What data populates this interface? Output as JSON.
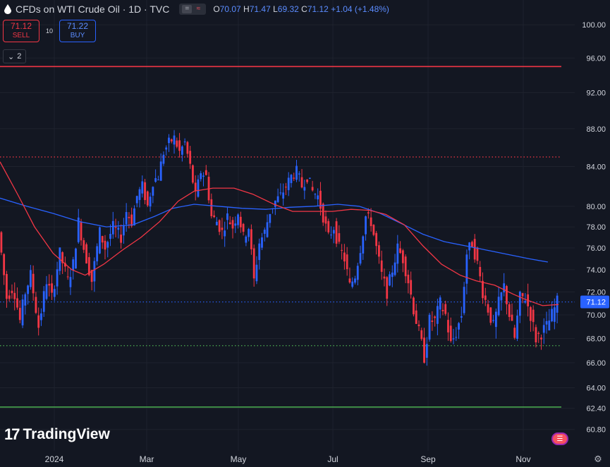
{
  "header": {
    "title": "CFDs on WTI Crude Oil · 1D · TVC",
    "ohlc": {
      "o_label": "O",
      "o": "70.07",
      "h_label": "H",
      "h": "71.47",
      "l_label": "L",
      "l": "69.32",
      "c_label": "C",
      "c": "71.12",
      "change": "+1.04 (+1.48%)"
    }
  },
  "trade": {
    "sell_price": "71.12",
    "sell_label": "SELL",
    "quantity": "10",
    "buy_price": "71.22",
    "buy_label": "BUY"
  },
  "indicators_toggle": {
    "label": "2",
    "icon": "chevron-down-icon"
  },
  "branding": {
    "logo_text": "TradingView",
    "logo_mark": "17"
  },
  "colors": {
    "background": "#131722",
    "up": "#2962ff",
    "down": "#f23645",
    "ma_fast": "#f23645",
    "ma_slow": "#2962ff",
    "resistance": "#f23645",
    "support": "#4caf50"
  },
  "chart_data": {
    "type": "candlestick",
    "x_axis_labels": [
      "2024",
      "Mar",
      "May",
      "Jul",
      "Sep",
      "Nov"
    ],
    "y_axis_labels": [
      "100.00",
      "96.00",
      "92.00",
      "88.00",
      "84.00",
      "80.00",
      "78.00",
      "76.00",
      "74.00",
      "72.00",
      "70.00",
      "68.00",
      "66.00",
      "64.00",
      "62.40",
      "60.80"
    ],
    "scale": "log",
    "ylim": [
      60.0,
      101.5
    ],
    "last_price": "71.12",
    "horizontal_lines": [
      {
        "price": 95.0,
        "style": "solid",
        "color": "#f23645"
      },
      {
        "price": 85.0,
        "style": "dotted",
        "color": "#f23645"
      },
      {
        "price": 71.12,
        "style": "dotted",
        "color": "#2962ff"
      },
      {
        "price": 67.4,
        "style": "dotted",
        "color": "#4caf50"
      },
      {
        "price": 62.5,
        "style": "solid",
        "color": "#4caf50"
      }
    ],
    "price_path": [
      [
        0,
        77.5
      ],
      [
        6,
        71.5
      ],
      [
        11,
        72.5
      ],
      [
        16,
        69.5
      ],
      [
        20,
        72.0
      ],
      [
        24,
        73.5
      ],
      [
        30,
        69.0
      ],
      [
        36,
        73.0
      ],
      [
        40,
        71.5
      ],
      [
        46,
        75.5
      ],
      [
        52,
        73.0
      ],
      [
        56,
        74.5
      ],
      [
        60,
        78.5
      ],
      [
        64,
        76.0
      ],
      [
        70,
        73.0
      ],
      [
        76,
        77.5
      ],
      [
        80,
        76.0
      ],
      [
        86,
        78.0
      ],
      [
        92,
        77.0
      ],
      [
        96,
        79.5
      ],
      [
        100,
        78.5
      ],
      [
        104,
        81.0
      ],
      [
        108,
        82.0
      ],
      [
        112,
        80.0
      ],
      [
        116,
        82.5
      ],
      [
        120,
        83.0
      ],
      [
        124,
        85.5
      ],
      [
        128,
        86.5
      ],
      [
        132,
        87.0
      ],
      [
        136,
        85.5
      ],
      [
        140,
        86.5
      ],
      [
        144,
        84.0
      ],
      [
        148,
        81.0
      ],
      [
        152,
        83.5
      ],
      [
        156,
        83.0
      ],
      [
        160,
        79.0
      ],
      [
        164,
        78.5
      ],
      [
        168,
        77.5
      ],
      [
        172,
        79.0
      ],
      [
        176,
        78.0
      ],
      [
        180,
        79.5
      ],
      [
        184,
        77.0
      ],
      [
        188,
        78.0
      ],
      [
        192,
        73.0
      ],
      [
        196,
        76.5
      ],
      [
        200,
        77.5
      ],
      [
        204,
        79.5
      ],
      [
        208,
        80.5
      ],
      [
        212,
        81.0
      ],
      [
        216,
        82.0
      ],
      [
        220,
        83.0
      ],
      [
        224,
        83.5
      ],
      [
        228,
        82.0
      ],
      [
        232,
        83.0
      ],
      [
        236,
        81.5
      ],
      [
        240,
        81.0
      ],
      [
        244,
        79.0
      ],
      [
        248,
        77.0
      ],
      [
        252,
        78.0
      ],
      [
        256,
        76.0
      ],
      [
        260,
        75.0
      ],
      [
        264,
        72.5
      ],
      [
        268,
        73.5
      ],
      [
        272,
        76.0
      ],
      [
        276,
        79.0
      ],
      [
        280,
        78.5
      ],
      [
        284,
        76.0
      ],
      [
        288,
        73.5
      ],
      [
        292,
        72.0
      ],
      [
        296,
        74.0
      ],
      [
        300,
        76.0
      ],
      [
        304,
        75.0
      ],
      [
        308,
        73.0
      ],
      [
        312,
        70.5
      ],
      [
        316,
        68.5
      ],
      [
        320,
        66.5
      ],
      [
        324,
        69.5
      ],
      [
        328,
        69.5
      ],
      [
        332,
        71.0
      ],
      [
        336,
        70.0
      ],
      [
        340,
        67.5
      ],
      [
        344,
        68.5
      ],
      [
        348,
        70.0
      ],
      [
        352,
        75.5
      ],
      [
        356,
        76.5
      ],
      [
        360,
        74.5
      ],
      [
        364,
        72.0
      ],
      [
        368,
        70.5
      ],
      [
        372,
        69.0
      ],
      [
        376,
        71.0
      ],
      [
        380,
        72.5
      ],
      [
        384,
        70.0
      ],
      [
        388,
        68.0
      ],
      [
        392,
        71.5
      ],
      [
        396,
        71.5
      ],
      [
        400,
        70.0
      ],
      [
        404,
        68.0
      ],
      [
        408,
        68.5
      ],
      [
        412,
        69.0
      ],
      [
        416,
        70.0
      ],
      [
        420,
        71.12
      ]
    ],
    "ma_fast": [
      [
        0,
        84.5
      ],
      [
        14,
        81.0
      ],
      [
        26,
        78.0
      ],
      [
        40,
        75.5
      ],
      [
        54,
        74.0
      ],
      [
        64,
        73.5
      ],
      [
        78,
        74.5
      ],
      [
        92,
        75.8
      ],
      [
        106,
        77.0
      ],
      [
        120,
        78.5
      ],
      [
        134,
        80.5
      ],
      [
        146,
        81.5
      ],
      [
        160,
        81.8
      ],
      [
        176,
        81.8
      ],
      [
        190,
        81.2
      ],
      [
        206,
        80.2
      ],
      [
        220,
        79.5
      ],
      [
        236,
        79.5
      ],
      [
        250,
        79.5
      ],
      [
        264,
        79.7
      ],
      [
        278,
        79.6
      ],
      [
        290,
        79.2
      ],
      [
        304,
        78.2
      ],
      [
        318,
        76.2
      ],
      [
        332,
        74.5
      ],
      [
        346,
        73.5
      ],
      [
        358,
        73.0
      ],
      [
        372,
        72.6
      ],
      [
        386,
        71.8
      ],
      [
        396,
        71.3
      ],
      [
        408,
        70.8
      ],
      [
        420,
        70.9
      ]
    ],
    "ma_slow": [
      [
        0,
        80.8
      ],
      [
        20,
        80.0
      ],
      [
        40,
        79.3
      ],
      [
        60,
        78.5
      ],
      [
        80,
        78.0
      ],
      [
        100,
        78.2
      ],
      [
        116,
        79.0
      ],
      [
        130,
        79.8
      ],
      [
        146,
        80.2
      ],
      [
        164,
        80.0
      ],
      [
        182,
        79.8
      ],
      [
        200,
        79.7
      ],
      [
        218,
        79.9
      ],
      [
        236,
        80.0
      ],
      [
        254,
        80.2
      ],
      [
        270,
        80.0
      ],
      [
        286,
        79.3
      ],
      [
        302,
        78.3
      ],
      [
        318,
        77.3
      ],
      [
        334,
        76.6
      ],
      [
        350,
        76.2
      ],
      [
        366,
        75.8
      ],
      [
        382,
        75.4
      ],
      [
        398,
        75.0
      ],
      [
        412,
        74.7
      ]
    ]
  }
}
